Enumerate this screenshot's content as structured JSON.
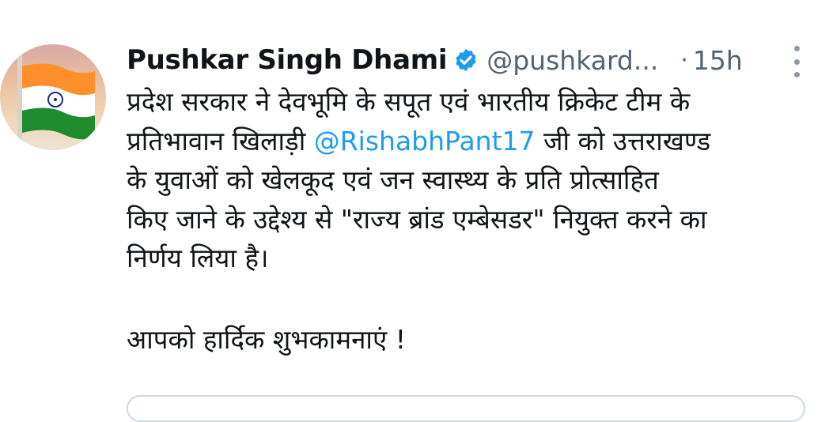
{
  "author": {
    "name": "Pushkar Singh Dhami",
    "handle": "@pushkard...",
    "separator": "·",
    "time": "15h",
    "verified_icon": "verified-badge-icon",
    "avatar": "indian-flag"
  },
  "tweet": {
    "line1": "प्रदेश सरकार ने देवभूमि के सपूत एवं भारतीय क्रिकेट टीम के",
    "line2_before": "प्रतिभावान खिलाड़ी ",
    "mention": "@RishabhPant17",
    "line2_after": " जी को उत्तराखण्ड",
    "line3": "के युवाओं को खेलकूद एवं जन स्वास्थ्य के प्रति प्रोत्साहित",
    "line4": "किए जाने के उद्देश्य से \"राज्य ब्रांड एम्बेसडर\" नियुक्त करने का",
    "line5": "निर्णय लिया है।",
    "greeting": "आपको हार्दिक शुभकामनाएं !"
  },
  "colors": {
    "text": "#0f1419",
    "muted": "#536471",
    "link": "#1d9bf0"
  },
  "icons": {
    "more": "more-options-icon"
  }
}
